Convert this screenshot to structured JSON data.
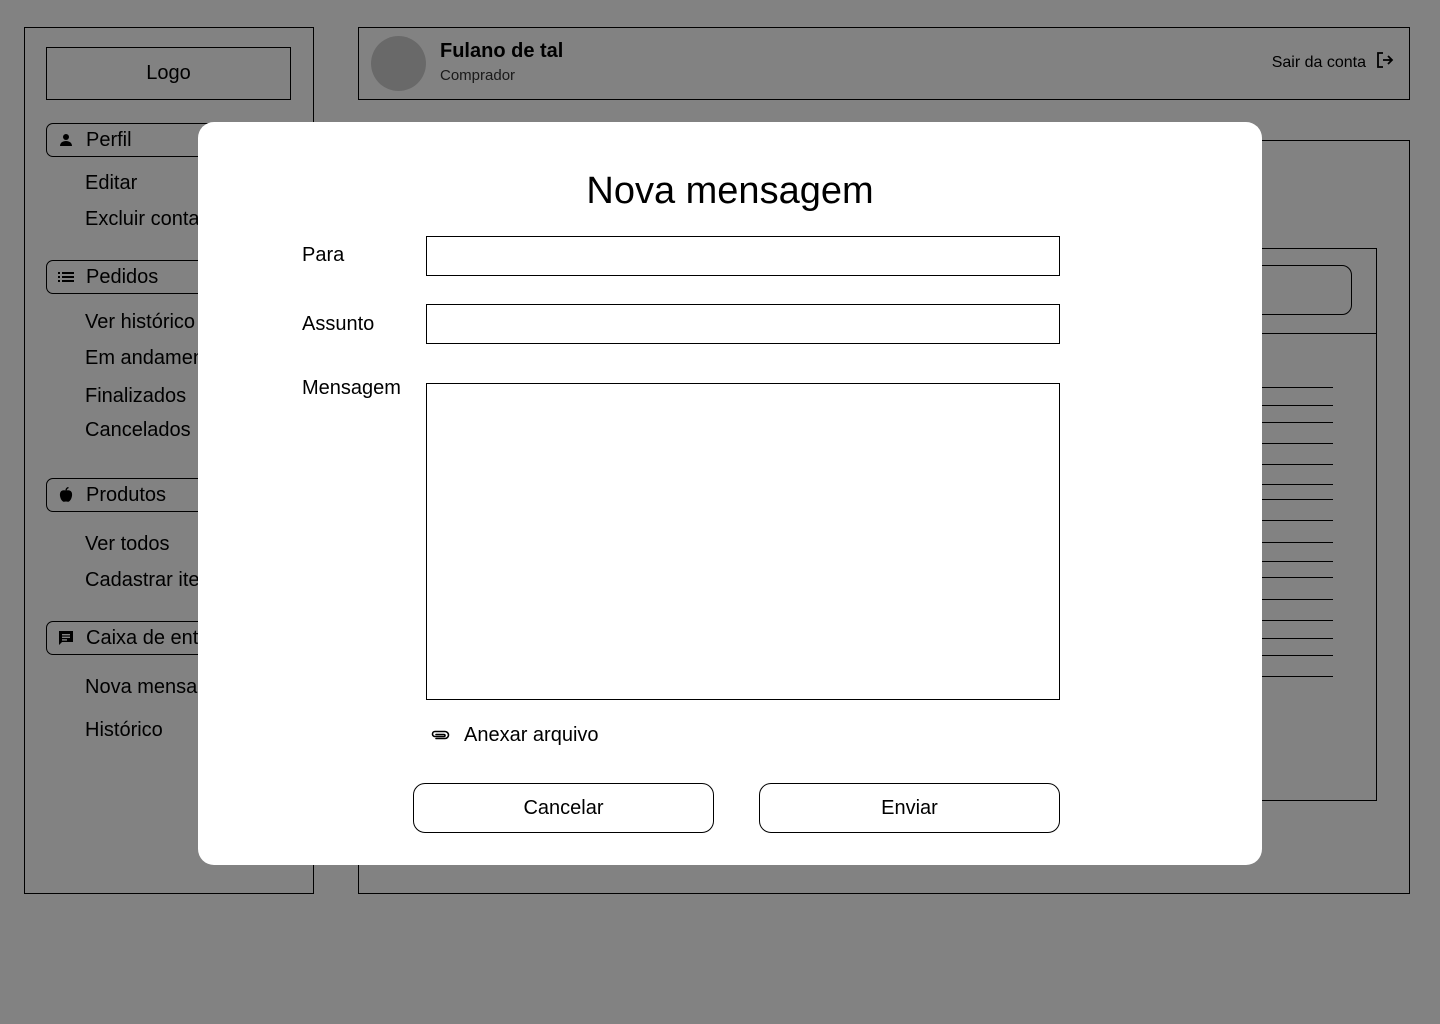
{
  "sidebar": {
    "logo": "Logo",
    "sections": [
      {
        "label": "Perfil",
        "icon": "person-icon",
        "items": [
          "Editar",
          "Excluir conta"
        ]
      },
      {
        "label": "Pedidos",
        "icon": "list-icon",
        "items": [
          "Ver histórico",
          "Em andamento",
          "Finalizados",
          "Cancelados"
        ]
      },
      {
        "label": "Produtos",
        "icon": "apple-icon",
        "items": [
          "Ver todos",
          "Cadastrar item"
        ]
      },
      {
        "label": "Caixa de entrada",
        "icon": "chat-icon",
        "items": [
          "Nova mensagem",
          "Histórico"
        ]
      }
    ]
  },
  "header": {
    "user_name": "Fulano de tal",
    "user_role": "Comprador",
    "logout_label": "Sair da conta"
  },
  "modal": {
    "title": "Nova mensagem",
    "to_label": "Para",
    "to_value": "",
    "subject_label": "Assunto",
    "subject_value": "",
    "message_label": "Mensagem",
    "message_value": "",
    "attach_label": "Anexar arquivo",
    "cancel_label": "Cancelar",
    "send_label": "Enviar"
  },
  "colors": {
    "overlay": "#808080",
    "modal_bg": "#ffffff",
    "border": "#000000"
  }
}
